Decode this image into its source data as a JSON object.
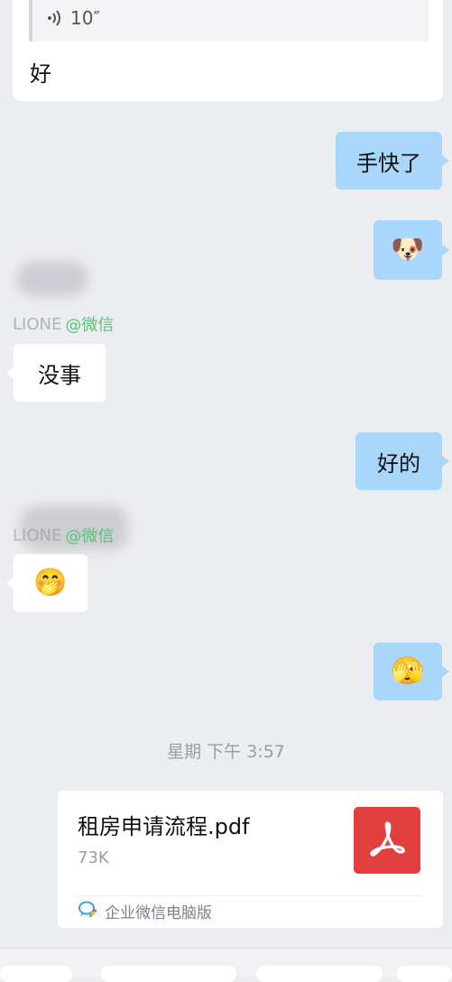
{
  "quoted": {
    "voice_duration": "10″",
    "reply_text": "好"
  },
  "messages": [
    {
      "id": "m1",
      "direction": "out",
      "type": "text",
      "text": "手快了"
    },
    {
      "id": "m2",
      "direction": "out",
      "type": "emoji",
      "emoji": "🐶",
      "icon": "doge-emoji-icon"
    },
    {
      "id": "m3",
      "direction": "in",
      "type": "text",
      "sender": "LIONE",
      "source": "@微信",
      "text": "没事"
    },
    {
      "id": "m4",
      "direction": "out",
      "type": "text",
      "text": "好的"
    },
    {
      "id": "m5",
      "direction": "in",
      "type": "emoji",
      "sender": "LIONE",
      "source": "@微信",
      "emoji": "🤭",
      "icon": "hand-over-mouth-emoji-icon"
    },
    {
      "id": "m6",
      "direction": "out",
      "type": "emoji",
      "emoji": "🫣",
      "icon": "peek-emoji-icon"
    }
  ],
  "timestamp": "星期 下午 3:57",
  "file": {
    "name": "租房申请流程.pdf",
    "size": "73K",
    "source": "企业微信电脑版",
    "icon": "pdf-icon"
  },
  "colors": {
    "out_bubble": "#a9d7fb",
    "in_bubble": "#ffffff",
    "background": "#ecedf1",
    "pdf_red": "#e2403f",
    "source_green": "#5fbf7b"
  }
}
